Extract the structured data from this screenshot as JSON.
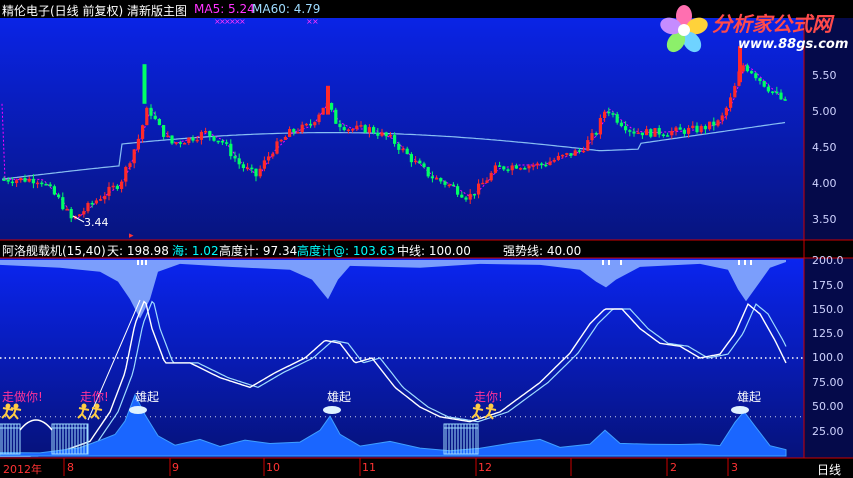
{
  "main_header": {
    "title": "精伦电子(日线 前复权) 清新版主图",
    "ma5": "MA5: 5.24",
    "ma60": "MA60: 4.79"
  },
  "logo": {
    "name": "分析家公式网",
    "url": "www.88gs.com"
  },
  "price_axis": [
    "5.50",
    "5.00",
    "4.50",
    "4.00",
    "3.50"
  ],
  "low_marker": "3.44",
  "indicator_header": {
    "name": "阿洛舰载机(15,40)",
    "tian": "天: 198.98",
    "hai": "海: 1.02",
    "gaodu": "高度计: 97.34",
    "gaodu_at": "高度计@: 103.63",
    "zhongxian": "中线: 100.00",
    "qiangshi": "强势线: 40.00"
  },
  "indicator_axis": [
    "200.0",
    "175.0",
    "150.0",
    "125.0",
    "100.0",
    "75.00",
    "50.00",
    "25.00"
  ],
  "signal_labels": {
    "zouzuoni": "走做你!",
    "zouni": "走你!",
    "xiongqi": "雄起"
  },
  "date_axis": [
    "2012年",
    "8",
    "9",
    "10",
    "11",
    "12",
    "2",
    "3"
  ],
  "period_label": "日线",
  "colors": {
    "up": "#ff2a2a",
    "down": "#00ff66",
    "ma5": "#ff00ff",
    "ma60": "#9fdcff",
    "label_magenta": "#ff3399",
    "hai": "#00ffff"
  }
}
